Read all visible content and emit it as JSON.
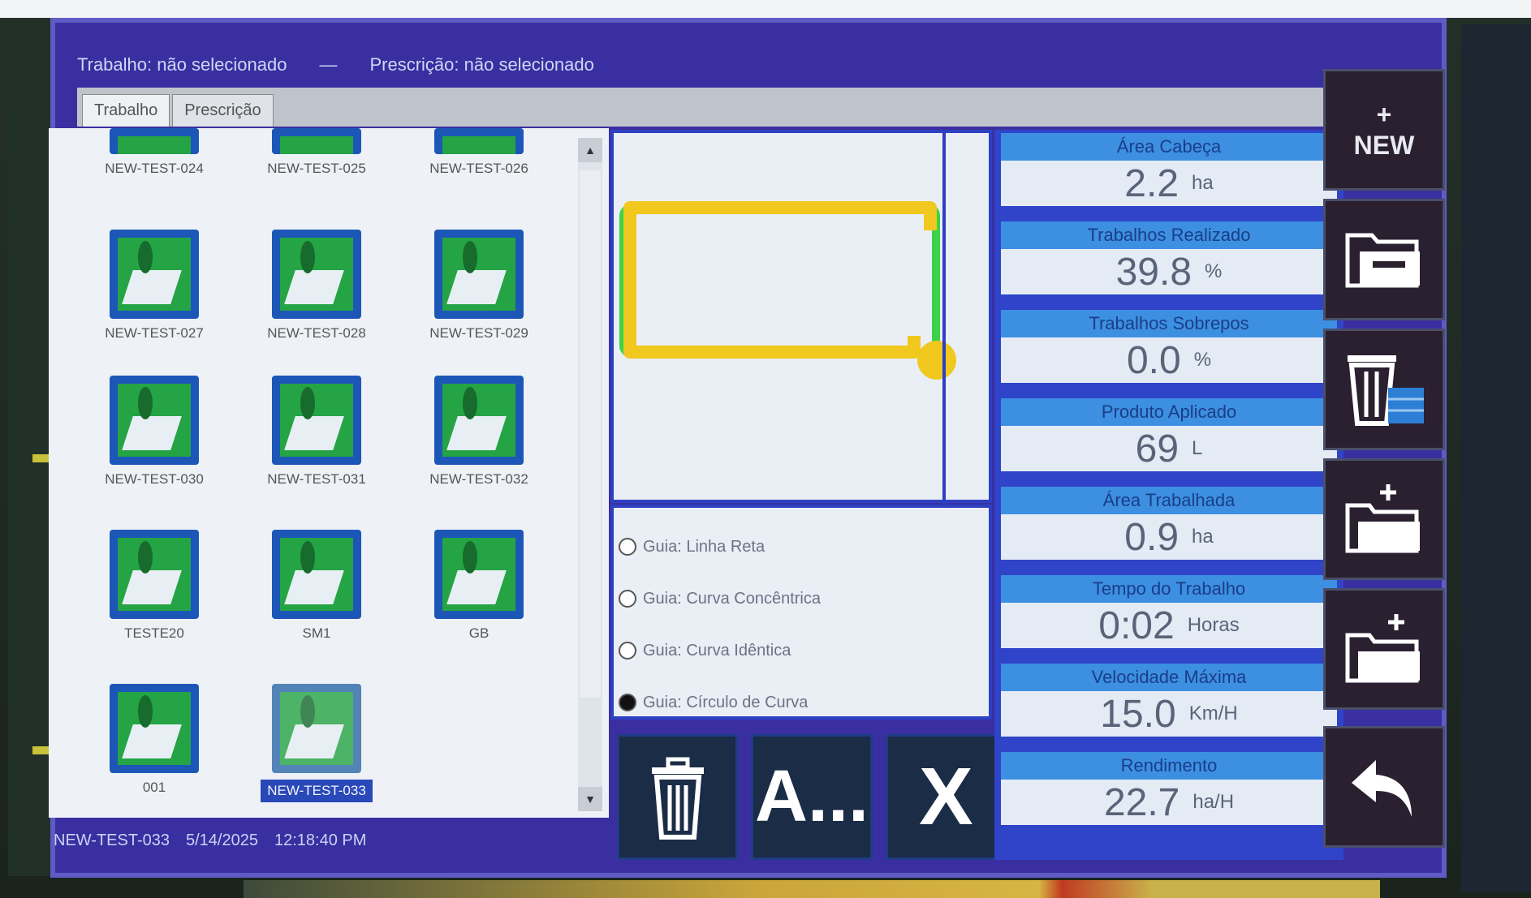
{
  "titlebar": {
    "work_label": "Trabalho: não selecionado",
    "separator": "—",
    "prescription_label": "Prescrição: não selecionado"
  },
  "tabs": [
    {
      "label": "Trabalho"
    },
    {
      "label": "Prescrição"
    }
  ],
  "files": [
    {
      "name": "NEW-TEST-024"
    },
    {
      "name": "NEW-TEST-025"
    },
    {
      "name": "NEW-TEST-026"
    },
    {
      "name": "NEW-TEST-027"
    },
    {
      "name": "NEW-TEST-028"
    },
    {
      "name": "NEW-TEST-029"
    },
    {
      "name": "NEW-TEST-030"
    },
    {
      "name": "NEW-TEST-031"
    },
    {
      "name": "NEW-TEST-032"
    },
    {
      "name": "TESTE20"
    },
    {
      "name": "SM1"
    },
    {
      "name": "GB"
    },
    {
      "name": "001"
    },
    {
      "name": "NEW-TEST-033"
    }
  ],
  "status": {
    "file": "NEW-TEST-033",
    "date": "5/14/2025",
    "time": "12:18:40 PM"
  },
  "guides": [
    {
      "label": "Guia: Linha Reta",
      "selected": false
    },
    {
      "label": "Guia: Curva Concêntrica",
      "selected": false
    },
    {
      "label": "Guia: Curva Idêntica",
      "selected": false
    },
    {
      "label": "Guia: Círculo de Curva",
      "selected": true
    }
  ],
  "actions": {
    "delete_icon": "trash-icon",
    "rename_label": "A...",
    "close_label": "X"
  },
  "stats": [
    {
      "label": "Área Cabeça",
      "value": "2.2",
      "unit": "ha"
    },
    {
      "label": "Trabalhos Realizado",
      "value": "39.8",
      "unit": "%"
    },
    {
      "label": "Trabalhos Sobrepos",
      "value": "0.0",
      "unit": "%"
    },
    {
      "label": "Produto Aplicado",
      "value": "69",
      "unit": "L"
    },
    {
      "label": "Área Trabalhada",
      "value": "0.9",
      "unit": "ha"
    },
    {
      "label": "Tempo do Trabalho",
      "value": "0:02",
      "unit": "Horas"
    },
    {
      "label": "Velocidade Máxima",
      "value": "15.0",
      "unit": "Km/H"
    },
    {
      "label": "Rendimento",
      "value": "22.7",
      "unit": "ha/H"
    }
  ],
  "toolbar": {
    "new_plus": "+",
    "new_label": "NEW",
    "open_icon": "folder-open-icon",
    "delete_icon": "trash-table-icon",
    "export_icon": "folder-export-icon",
    "import_icon": "folder-import-icon",
    "back_icon": "back-arrow-icon"
  },
  "colors": {
    "window": "#3a2fa0",
    "stat_header": "#3d8fe1",
    "boundary_yellow": "#f0c81e",
    "path_green": "#3cd24a"
  }
}
